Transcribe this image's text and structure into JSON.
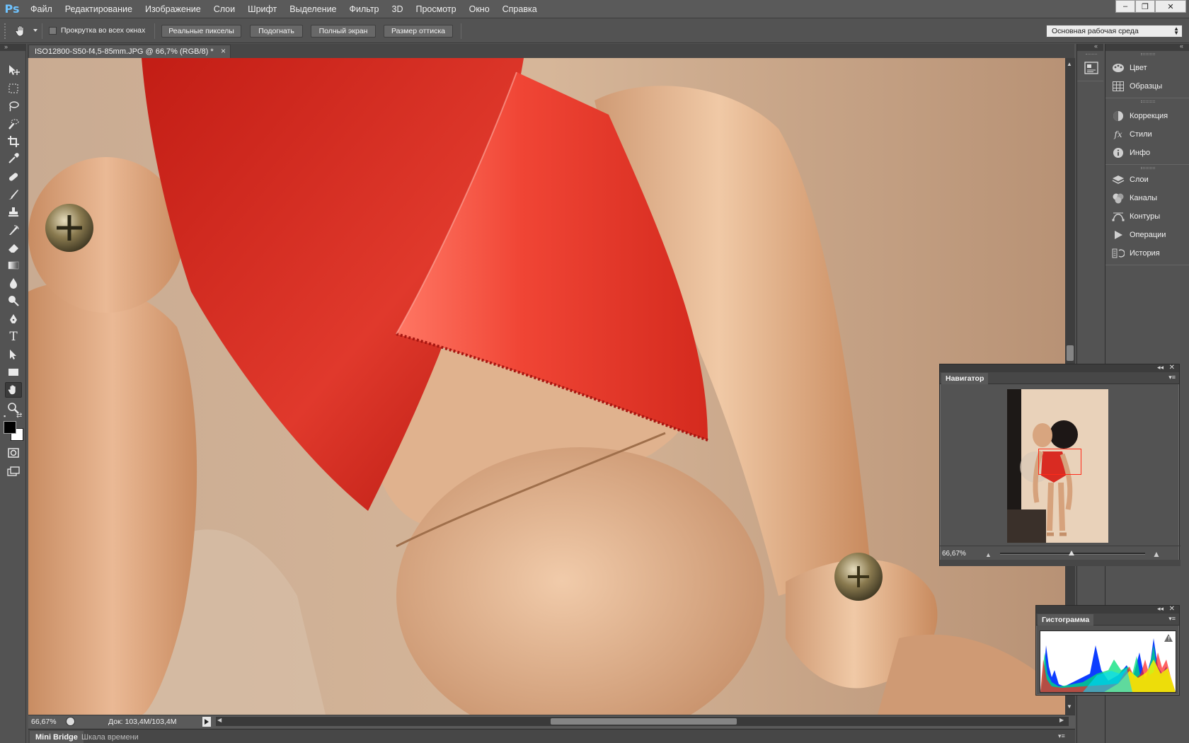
{
  "app": {
    "logo": "Ps",
    "menu": [
      "Файл",
      "Редактирование",
      "Изображение",
      "Слои",
      "Шрифт",
      "Выделение",
      "Фильтр",
      "3D",
      "Просмотр",
      "Окно",
      "Справка"
    ],
    "window_controls": [
      "–",
      "❐",
      "✕"
    ]
  },
  "options_bar": {
    "scroll_all_label": "Прокрутка во всех окнах",
    "buttons": [
      "Реальные пикселы",
      "Подогнать",
      "Полный экран",
      "Размер оттиска"
    ],
    "workspace": "Основная рабочая среда"
  },
  "document": {
    "tab_title": "ISO12800-S50-f4,5-85mm.JPG @ 66,7% (RGB/8) *",
    "close_glyph": "×"
  },
  "status": {
    "zoom": "66,67%",
    "doc_info": "Док: 103,4M/103,4M"
  },
  "bottom_tabs": [
    "Mini Bridge",
    "Шкала времени"
  ],
  "panels_dock": {
    "groups": [
      [
        "Цвет",
        "Образцы"
      ],
      [
        "Коррекция",
        "Стили",
        "Инфо"
      ],
      [
        "Слои",
        "Каналы",
        "Контуры",
        "Операции",
        "История"
      ]
    ]
  },
  "navigator": {
    "title": "Навигатор",
    "zoom": "66,67%"
  },
  "histogram": {
    "title": "Гистограмма",
    "warning": "!"
  },
  "colors": {
    "ribbon": "#e8352a",
    "wood": "#dca883",
    "accent_logo": "#6fc3ff"
  }
}
